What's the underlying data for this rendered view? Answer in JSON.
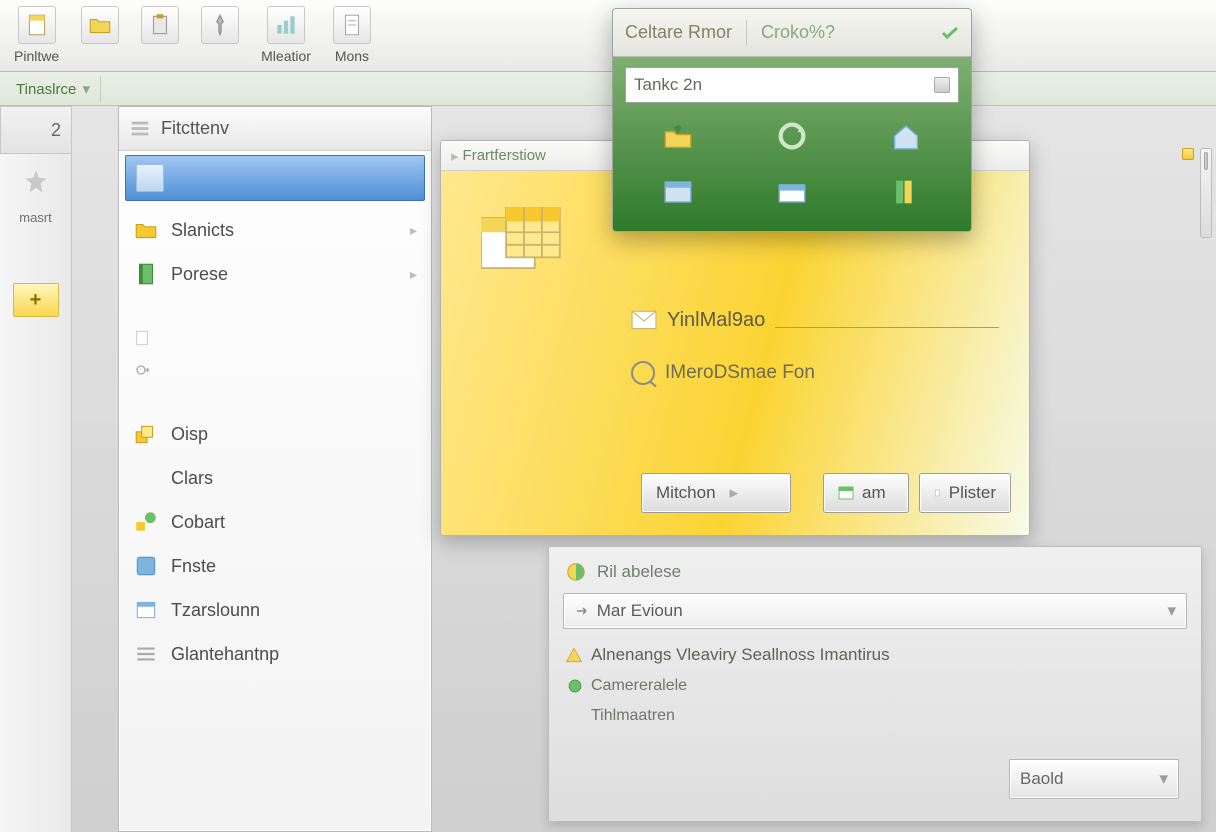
{
  "ribbon": {
    "items": [
      {
        "label": "Pinltwe"
      },
      {
        "label": ""
      },
      {
        "label": ""
      },
      {
        "label": ""
      },
      {
        "label": "Mleatior"
      },
      {
        "label": "Mons"
      }
    ]
  },
  "tabstrip": {
    "tab": "Tinaslrce"
  },
  "gutter": {
    "row": "2"
  },
  "vbar": {
    "label": "masrt",
    "plus": "+"
  },
  "sidepanel": {
    "header": "Fitcttenv",
    "items": [
      {
        "label": "Slanicts"
      },
      {
        "label": "Porese"
      },
      {
        "label": "Oisp"
      },
      {
        "label": "Clars"
      },
      {
        "label": "Cobart"
      },
      {
        "label": "Fnste"
      },
      {
        "label": "Tzarslounn"
      },
      {
        "label": "Glantehantnp"
      }
    ]
  },
  "drop": {
    "title_a": "Celtare Rmor",
    "title_b": "Croko%?",
    "input": "Tankc 2n"
  },
  "ypanel": {
    "title": "Frartferstiow",
    "row1": "YinlMal9ao",
    "row2": "IMeroDSmae Fon",
    "btn_m": "Mitchon",
    "btn_a": "am",
    "btn_p": "Plister"
  },
  "gpanel": {
    "header": "Ril abelese",
    "select1": "Mar Evioun",
    "row1": "Alnenangs Vleaviry Seallnoss Imantirus",
    "row2": "Camereralele",
    "row3": "Tihlmaatren",
    "select2": "Baold"
  }
}
